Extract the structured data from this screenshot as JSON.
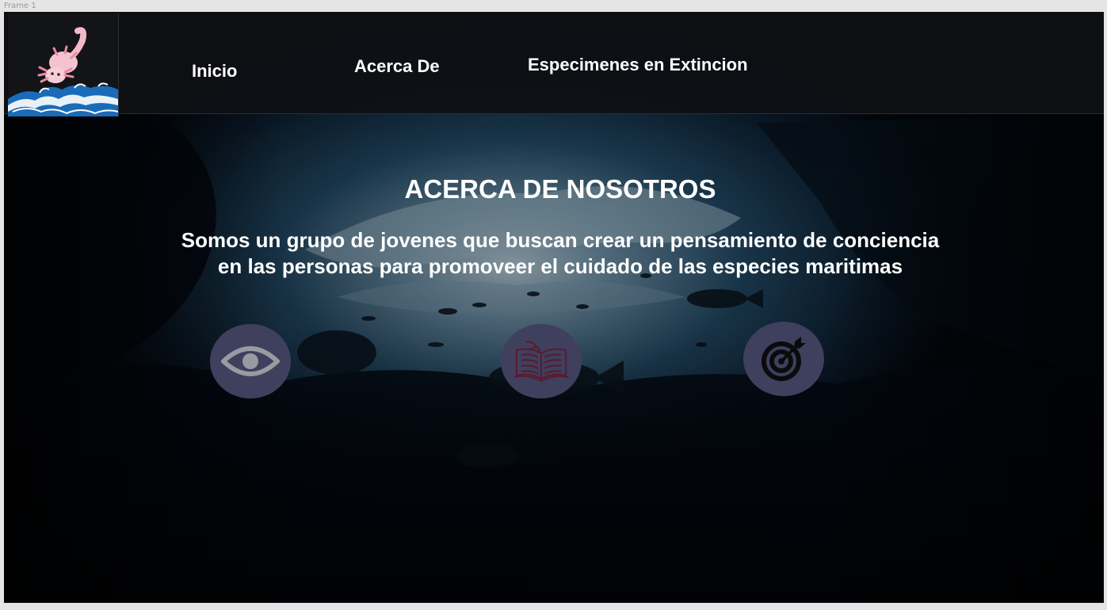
{
  "canvas": {
    "frame_label": "Frame 1"
  },
  "navbar": {
    "links": [
      {
        "label": "Inicio"
      },
      {
        "label": "Acerca De"
      },
      {
        "label": "Especimenes en Extincion"
      }
    ]
  },
  "hero": {
    "title": "ACERCA DE NOSOTROS",
    "description_lines": [
      "Somos un grupo de jovenes que buscan crear un pensamiento de conciencia",
      "en las personas para promoveer el cuidado de las especies maritimas"
    ]
  },
  "icons": {
    "logo": "axolotl-wave-logo",
    "buttons": [
      "eye-icon",
      "open-book-icon",
      "target-icon"
    ]
  },
  "colors": {
    "navbar_bg": "#0e1014",
    "button_circle": "#3f3f5e",
    "text": "#ffffff",
    "eye_icon": "#9a9aa2",
    "book_icon": "#5a1a2e",
    "target_icon": "#0b0b0e"
  }
}
